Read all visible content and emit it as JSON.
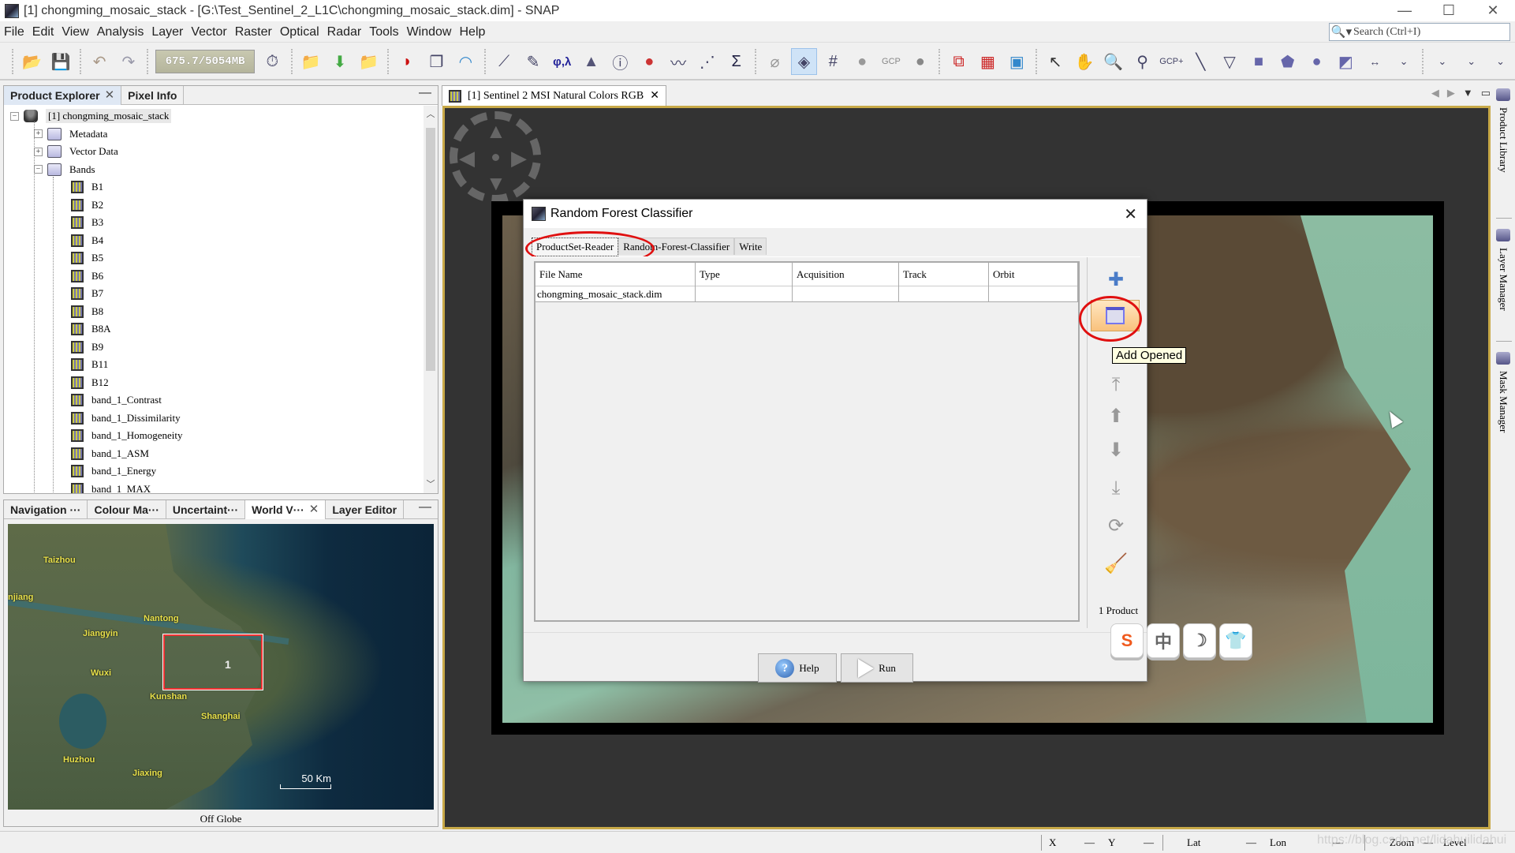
{
  "window": {
    "title": "[1] chongming_mosaic_stack - [G:\\Test_Sentinel_2_L1C\\chongming_mosaic_stack.dim] - SNAP",
    "minimize": "—",
    "maximize": "☐",
    "close": "✕"
  },
  "menu": [
    "File",
    "Edit",
    "View",
    "Analysis",
    "Layer",
    "Vector",
    "Raster",
    "Optical",
    "Radar",
    "Tools",
    "Window",
    "Help"
  ],
  "search": {
    "placeholder": "Search (Ctrl+I)",
    "icon": "search-icon"
  },
  "toolbar": {
    "memory": "675.7/5054MB",
    "icons": [
      "open-product",
      "save-product",
      "undo",
      "redo",
      "memory-gauge",
      "session",
      "import-vector",
      "import-shape",
      "export",
      "rgb-image",
      "multi-view",
      "wave",
      "plot",
      "edit-pen",
      "geo-coding",
      "histogram",
      "information",
      "mask-info",
      "spectrum",
      "scatter-plot",
      "statistics",
      "no-sync",
      "sync-views",
      "graticule",
      "pin-manager",
      "gcp-manager",
      "world-map",
      "graph-builder",
      "batch",
      "world-wind",
      "select-tool",
      "pan-tool",
      "zoom-tool",
      "pin-placing",
      "gcp-placing",
      "line-tool",
      "polyline-tool",
      "rectangle-tool",
      "polygon-tool",
      "ellipse-tool",
      "mask-tool",
      "range-finder"
    ]
  },
  "product_explorer": {
    "tabs": [
      {
        "label": "Product Explorer",
        "closable": true,
        "active": true
      },
      {
        "label": "Pixel Info"
      }
    ],
    "minimize": "—",
    "root": "[1]  chongming_mosaic_stack",
    "nodes": [
      "Metadata",
      "Vector Data",
      "Bands"
    ],
    "bands": [
      "B1",
      "B2",
      "B3",
      "B4",
      "B5",
      "B6",
      "B7",
      "B8",
      "B8A",
      "B9",
      "B11",
      "B12",
      "band_1_Contrast",
      "band_1_Dissimilarity",
      "band_1_Homogeneity",
      "band_1_ASM",
      "band_1_Energy",
      "band_1_MAX"
    ]
  },
  "bottom_panel": {
    "tabs": [
      "Navigation ···",
      "Colour Ma···",
      "Uncertaint···",
      "World V···",
      "Layer Editor"
    ],
    "active_tab": "World V···",
    "map_labels": [
      "Taizhou",
      "njiang",
      "Nantong",
      "Jiangyin",
      "Wuxi",
      "Kunshan",
      "Shanghai",
      "Huzhou",
      "Jiaxing"
    ],
    "roi_label": "1",
    "scale": "50 Km",
    "status": "Off Globe"
  },
  "image_view": {
    "tab_label": "[1] Sentinel 2 MSI Natural Colors RGB",
    "close": "✕"
  },
  "dialog": {
    "title": "Random Forest Classifier",
    "close": "✕",
    "tabs": [
      "ProductSet-Reader",
      "Random-Forest-Classifier",
      "Write"
    ],
    "active_tab": "ProductSet-Reader",
    "columns": [
      "File Name",
      "Type",
      "Acquisition",
      "Track",
      "Orbit"
    ],
    "rows": [
      [
        "chongming_mosaic_stack.dim",
        "",
        "",
        "",
        ""
      ]
    ],
    "side_buttons": [
      "add",
      "add-opened",
      "remove",
      "move-top",
      "move-up",
      "move-down",
      "move-bottom",
      "refresh",
      "clear"
    ],
    "tooltip": "Add Opened",
    "product_count": "1 Product",
    "help": "Help",
    "run": "Run"
  },
  "ime": [
    "S",
    "中",
    "☽",
    "👕"
  ],
  "right_dock": [
    "Product Library",
    "Layer Manager",
    "Mask Manager"
  ],
  "statusbar": {
    "x_label": "X",
    "x_val": "—",
    "y_label": "Y",
    "y_val": "—",
    "lat_label": "Lat",
    "lat_val": "—",
    "lon_label": "Lon",
    "lon_val": "—",
    "zoom_label": "Zoom",
    "zoom_val": "—",
    "level_label": "Level",
    "level_val": "—"
  },
  "watermark": "https://blog.csdn.net/lidahuilidahui",
  "colors": {
    "highlight_circle": "#e01010",
    "view_border": "#c8a948",
    "tooltip_bg": "#ffffe1"
  }
}
